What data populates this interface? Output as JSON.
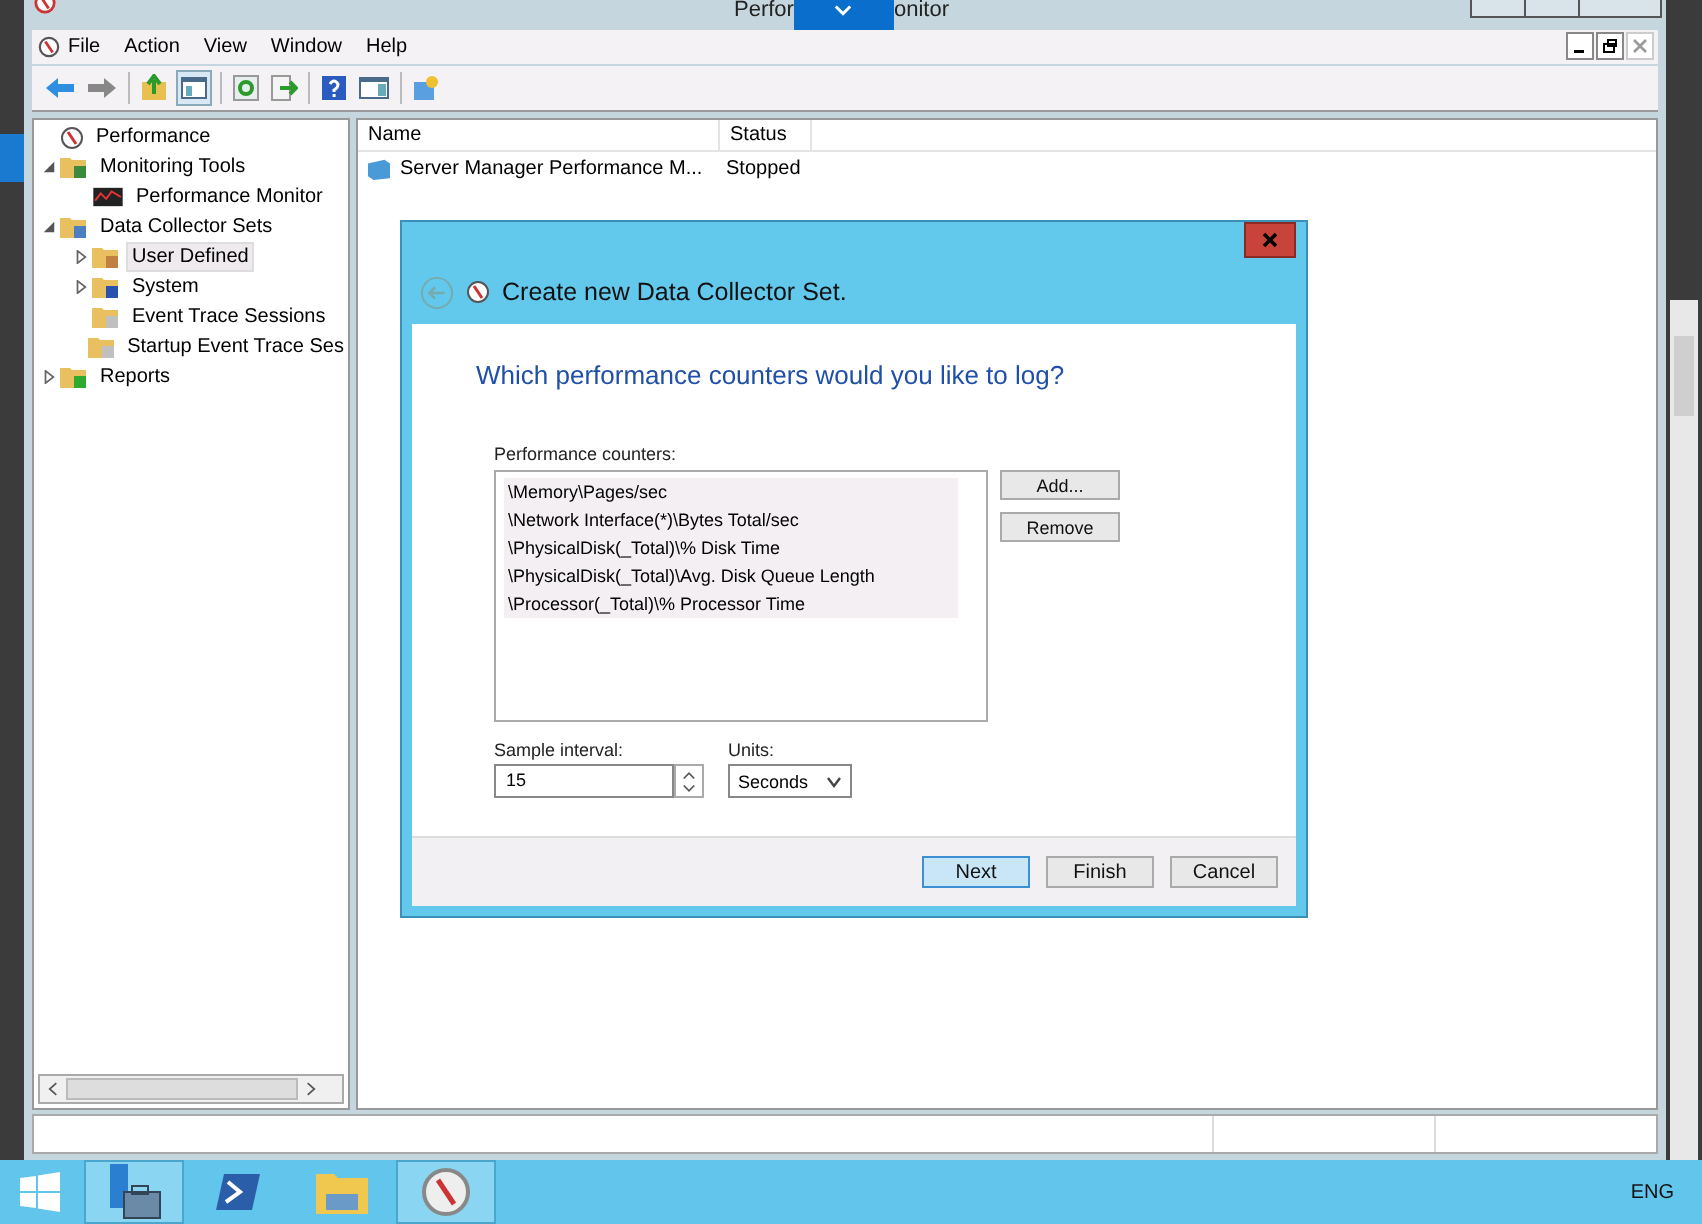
{
  "window": {
    "title_parts": [
      "Perfor",
      "onitor"
    ]
  },
  "menu": [
    "File",
    "Action",
    "View",
    "Window",
    "Help"
  ],
  "tree": [
    {
      "label": "Performance",
      "kind": "app",
      "selected": false
    },
    {
      "label": "Monitoring Tools",
      "kind": "tools",
      "expanded": true,
      "selected": false,
      "children": [
        {
          "label": "Performance Monitor",
          "kind": "monitor",
          "selected": false
        }
      ]
    },
    {
      "label": "Data Collector Sets",
      "kind": "sets",
      "expanded": true,
      "selected": false,
      "children": [
        {
          "label": "User Defined",
          "kind": "user",
          "expanded": false,
          "selected": true
        },
        {
          "label": "System",
          "kind": "system",
          "expanded": false,
          "selected": false
        },
        {
          "label": "Event Trace Sessions",
          "kind": "trace",
          "selected": false
        },
        {
          "label": "Startup Event Trace Ses",
          "kind": "trace",
          "selected": false
        }
      ]
    },
    {
      "label": "Reports",
      "kind": "report",
      "expanded": false,
      "selected": false
    }
  ],
  "table": {
    "columns": [
      "Name",
      "Status"
    ],
    "rows": [
      {
        "name": "Server Manager Performance M...",
        "status": "Stopped"
      }
    ]
  },
  "dialog": {
    "title": "Create new Data Collector Set.",
    "question": "Which performance counters would you like to log?",
    "counters_label": "Performance counters:",
    "counters": [
      {
        "text": "\\Memory\\Pages/sec",
        "selected": true
      },
      {
        "text": "\\Network Interface(*)\\Bytes Total/sec",
        "selected": true
      },
      {
        "text": "\\PhysicalDisk(_Total)\\% Disk Time",
        "selected": true
      },
      {
        "text": "\\PhysicalDisk(_Total)\\Avg. Disk Queue Length",
        "selected": true
      },
      {
        "text": "\\Processor(_Total)\\% Processor Time",
        "selected": true
      }
    ],
    "side_buttons": [
      "Add...",
      "Remove"
    ],
    "sample_interval": {
      "label": "Sample interval:",
      "value": "15"
    },
    "units": {
      "label": "Units:",
      "value": "Seconds"
    },
    "footer_buttons": [
      {
        "label": "Next",
        "focused": true
      },
      {
        "label": "Finish",
        "focused": false
      },
      {
        "label": "Cancel",
        "focused": false
      }
    ]
  },
  "taskbar": {
    "items": [
      {
        "kind": "start",
        "active": false
      },
      {
        "kind": "server",
        "active": true
      },
      {
        "kind": "shell",
        "active": false
      },
      {
        "kind": "folder",
        "active": false
      },
      {
        "kind": "perf",
        "active": true
      }
    ],
    "language": "ENG"
  }
}
